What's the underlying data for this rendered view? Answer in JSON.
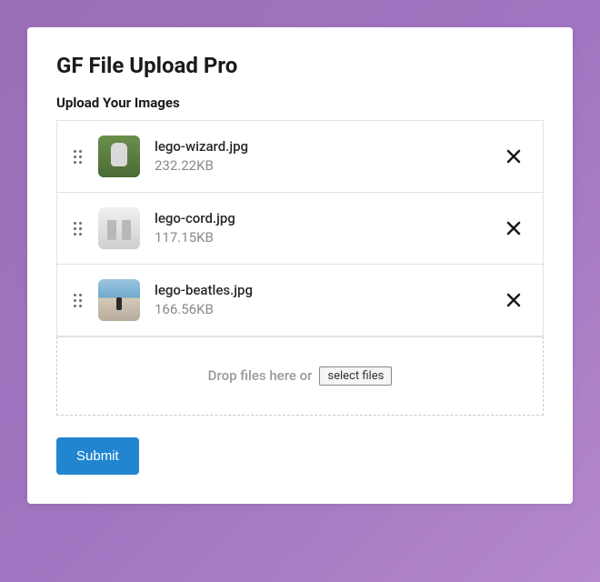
{
  "title": "GF File Upload Pro",
  "field_label": "Upload Your Images",
  "files": [
    {
      "name": "lego-wizard.jpg",
      "size": "232.22KB"
    },
    {
      "name": "lego-cord.jpg",
      "size": "117.15KB"
    },
    {
      "name": "lego-beatles.jpg",
      "size": "166.56KB"
    }
  ],
  "drop_zone": {
    "text": "Drop files here or",
    "button_label": "select files"
  },
  "submit_label": "Submit"
}
